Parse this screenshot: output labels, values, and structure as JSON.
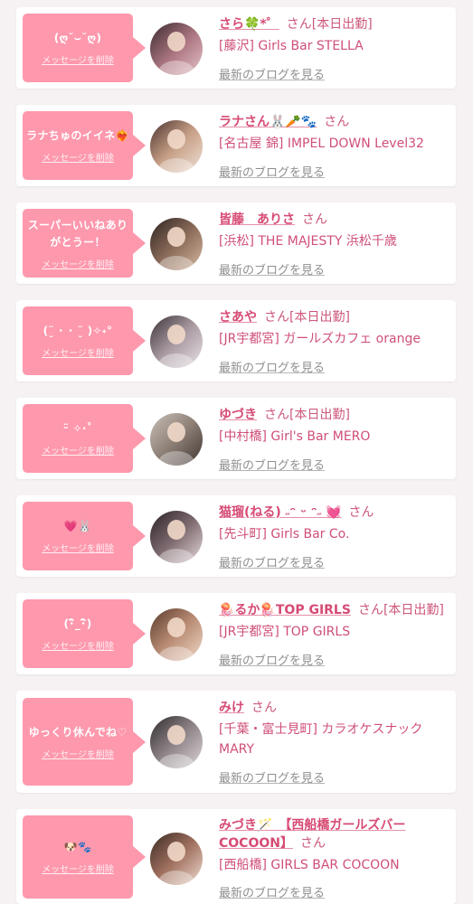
{
  "delete_label": "メッセージを削除",
  "blog_label": "最新のブログを見る",
  "san_label": "さん",
  "colors": {
    "bubble": "#fe98ad",
    "name": "#d64b74",
    "blog": "#8f8f8f"
  },
  "cards": [
    {
      "message": "(ღ˘⌣˘ღ)",
      "name": "さら🍀*゜",
      "work": "[本日出勤]",
      "store": "[藤沢] Girls Bar STELLA"
    },
    {
      "message": "ラナちゅのイイネ❤️‍🔥",
      "name": "ラナさん🐰🥕🐾",
      "work": "",
      "store": "[名古屋 錦] IMPEL DOWN Level32"
    },
    {
      "message": "スーパーいいねありがとうー！",
      "name": "皆藤　ありさ",
      "work": "",
      "store": "[浜松] THE MAJESTY 浜松千歳"
    },
    {
      "message": "(¨̮ ･ ･ ¨̮ )✧˖°",
      "name": "さあや",
      "work": "[本日出勤]",
      "store": "[JR宇都宮] ガールズカフェ orange"
    },
    {
      "message": "ᵕ̈ ✧·˚",
      "name": "ゆづき",
      "work": "[本日出勤]",
      "store": "[中村橋] Girl's Bar MERO"
    },
    {
      "message": "💗🐰",
      "name": "猫瑠(ねる) ˶ᵔ ᵕ ᵔ˶ 💓",
      "work": "",
      "store": "[先斗町] Girls Bar Co."
    },
    {
      "message": "(･ิ_･ิ)",
      "name": "🪼るか🪼TOP GIRLS",
      "work": "[本日出勤]",
      "store": "[JR宇都宮] TOP GIRLS"
    },
    {
      "message": "ゆっくり休んでね♡",
      "name": "みけ",
      "work": "",
      "store": "[千葉・富士見町] カラオケスナック MARY"
    },
    {
      "message": "🐶🐾",
      "name": "みづき🪄　【西船橋ガールズバーCOCOON】",
      "work": "",
      "store": "[西船橋] GIRLS BAR COCOON"
    }
  ]
}
